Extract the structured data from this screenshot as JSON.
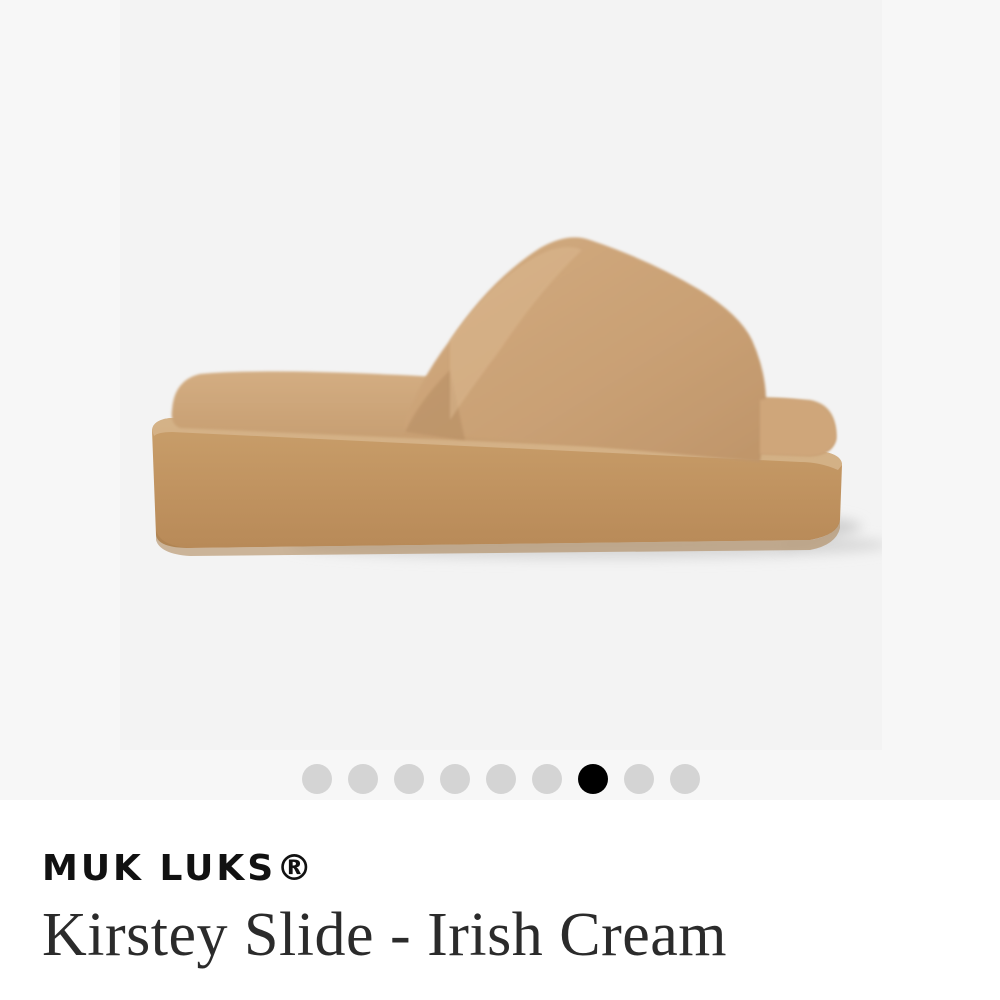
{
  "gallery": {
    "image_alt": "Kirstey Slide - Irish Cream",
    "dot_count": 9,
    "active_index": 6,
    "colors": {
      "dot_inactive": "#d4d4d4",
      "dot_active": "#000000",
      "background": "#f3f3f3",
      "fur": "#c9a276",
      "sole": "#c59a66"
    }
  },
  "product": {
    "brand": "MUK LUKS®",
    "name": "Kirstey Slide - Irish Cream"
  }
}
